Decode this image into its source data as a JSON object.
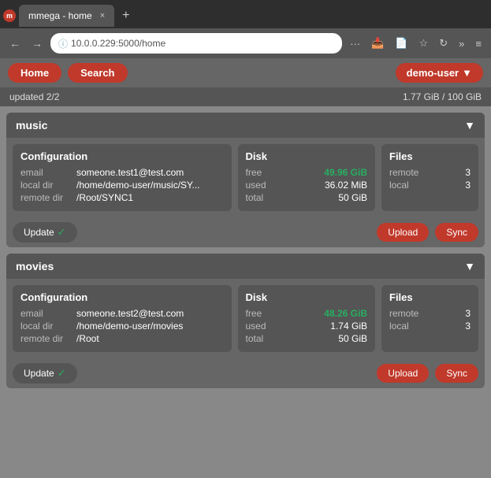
{
  "browser": {
    "tab_label": "mmega - home",
    "tab_close": "×",
    "new_tab_icon": "+",
    "back_icon": "←",
    "forward_icon": "→",
    "address": "10.0.0.229:5000/home",
    "more_icon": "···",
    "reload_icon": "↻",
    "more_tools_icon": "»",
    "menu_icon": "≡",
    "pocket_icon": "📥",
    "reader_icon": "📄",
    "bookmark_icon": "☆"
  },
  "app": {
    "nav": {
      "home_label": "Home",
      "search_label": "Search",
      "user_label": "demo-user",
      "user_arrow": "▼"
    },
    "status": {
      "updated": "updated 2/2",
      "storage": "1.77 GiB / 100 GiB"
    },
    "sections": [
      {
        "id": "music",
        "name": "music",
        "arrow": "▼",
        "config": {
          "title": "Configuration",
          "email_label": "email",
          "email_value": "someone.test1@test.com",
          "local_dir_label": "local dir",
          "local_dir_value": "/home/demo-user/music/SY...",
          "remote_dir_label": "remote dir",
          "remote_dir_value": "/Root/SYNC1"
        },
        "disk": {
          "title": "Disk",
          "free_label": "free",
          "free_value": "49.96 GiB",
          "used_label": "used",
          "used_value": "36.02 MiB",
          "total_label": "total",
          "total_value": "50 GiB"
        },
        "files": {
          "title": "Files",
          "remote_label": "remote",
          "remote_value": "3",
          "local_label": "local",
          "local_value": "3"
        },
        "footer": {
          "update_label": "Update",
          "update_check": "✓",
          "upload_label": "Upload",
          "sync_label": "Sync"
        }
      },
      {
        "id": "movies",
        "name": "movies",
        "arrow": "▼",
        "config": {
          "title": "Configuration",
          "email_label": "email",
          "email_value": "someone.test2@test.com",
          "local_dir_label": "local dir",
          "local_dir_value": "/home/demo-user/movies",
          "remote_dir_label": "remote dir",
          "remote_dir_value": "/Root"
        },
        "disk": {
          "title": "Disk",
          "free_label": "free",
          "free_value": "48.26 GiB",
          "used_label": "used",
          "used_value": "1.74 GiB",
          "total_label": "total",
          "total_value": "50 GiB"
        },
        "files": {
          "title": "Files",
          "remote_label": "remote",
          "remote_value": "3",
          "local_label": "local",
          "local_value": "3"
        },
        "footer": {
          "update_label": "Update",
          "update_check": "✓",
          "upload_label": "Upload",
          "sync_label": "Sync"
        }
      }
    ]
  }
}
